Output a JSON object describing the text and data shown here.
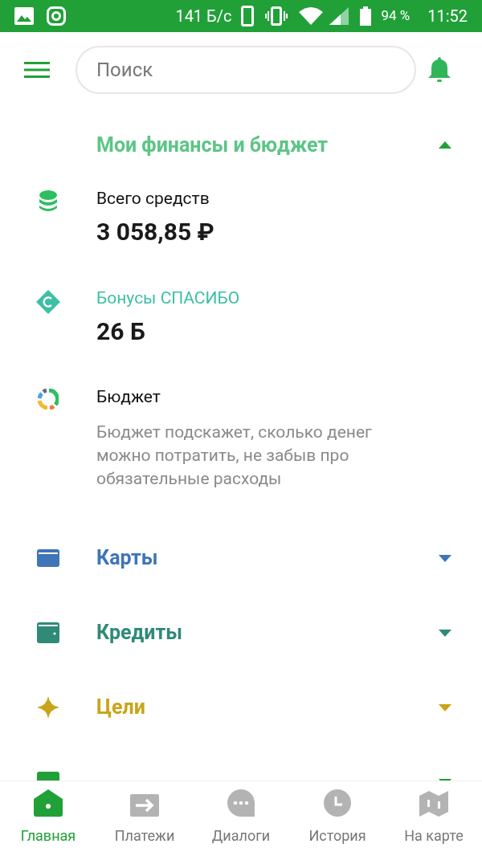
{
  "status_bar": {
    "speed": "141 Б/с",
    "battery": "94 %",
    "time": "11:52"
  },
  "search": {
    "placeholder": "Поиск"
  },
  "finances": {
    "title": "Мои финансы и бюджет",
    "expanded": true,
    "items": [
      {
        "kind": "balance",
        "label": "Всего средств",
        "value": "3 058,85 ₽"
      },
      {
        "kind": "bonus",
        "label": "Бонусы СПАСИБО",
        "value": "26 Б"
      },
      {
        "kind": "budget",
        "label": "Бюджет",
        "description": "Бюджет подскажет, сколько денег можно потратить, не забыв про обязательные расходы"
      }
    ]
  },
  "sections": [
    {
      "kind": "cards",
      "title": "Карты",
      "color": "#3f74b8",
      "expanded": false
    },
    {
      "kind": "credits",
      "title": "Кредиты",
      "color": "#2f8a78",
      "expanded": false
    },
    {
      "kind": "goals",
      "title": "Цели",
      "color": "#c9a418",
      "expanded": false
    },
    {
      "kind": "investments",
      "color": "#21a038",
      "expanded": false
    }
  ],
  "bottom_nav": [
    {
      "kind": "home",
      "label": "Главная",
      "selected": true
    },
    {
      "kind": "payments",
      "label": "Платежи",
      "selected": false
    },
    {
      "kind": "dialogs",
      "label": "Диалоги",
      "selected": false
    },
    {
      "kind": "history",
      "label": "История",
      "selected": false
    },
    {
      "kind": "map",
      "label": "На карте",
      "selected": false
    }
  ]
}
